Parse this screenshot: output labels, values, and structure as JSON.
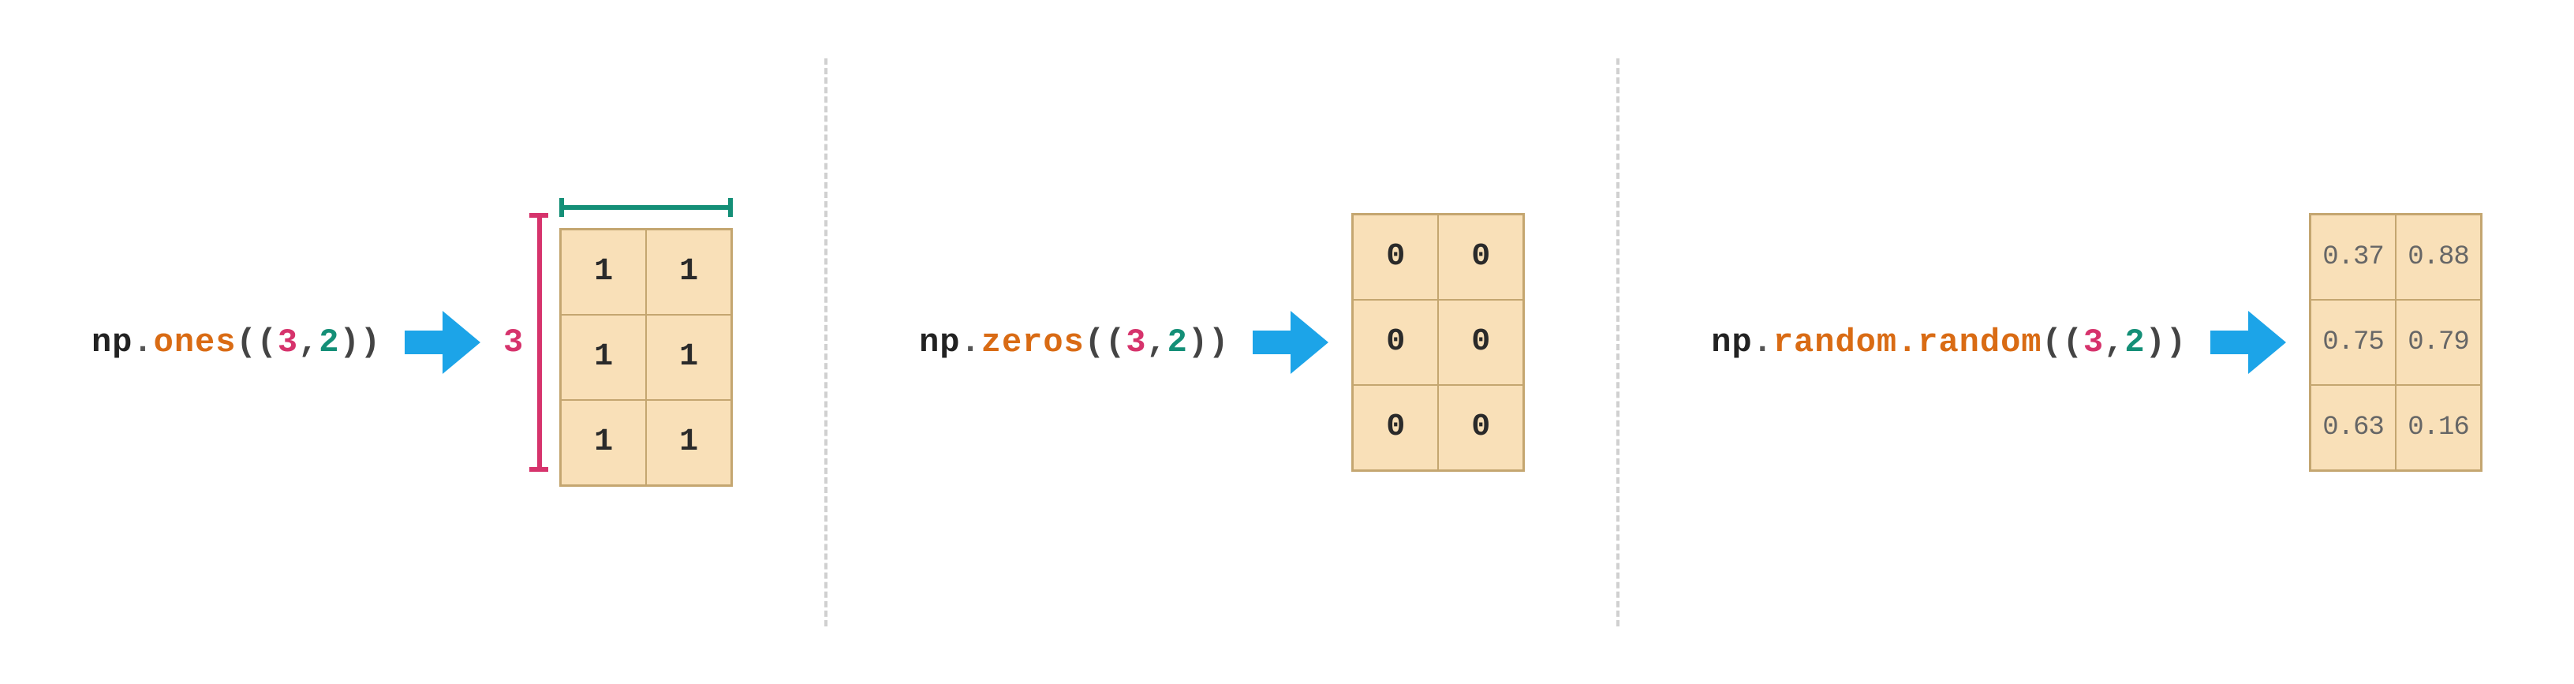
{
  "panels": [
    {
      "code": {
        "module": "np",
        "fn": "ones",
        "arg1": "3",
        "arg2": "2"
      },
      "show_dims": true,
      "dim_label": "3",
      "cells": [
        "1",
        "1",
        "1",
        "1",
        "1",
        "1"
      ],
      "small_cells": false
    },
    {
      "code": {
        "module": "np",
        "fn": "zeros",
        "arg1": "3",
        "arg2": "2"
      },
      "show_dims": false,
      "cells": [
        "0",
        "0",
        "0",
        "0",
        "0",
        "0"
      ],
      "small_cells": false
    },
    {
      "code": {
        "module": "np",
        "fn": "random.random",
        "arg1": "3",
        "arg2": "2"
      },
      "show_dims": false,
      "cells": [
        "0.37",
        "0.88",
        "0.75",
        "0.79",
        "0.63",
        "0.16"
      ],
      "small_cells": true
    }
  ],
  "colors": {
    "arrow": "#1ca4e8",
    "cell_bg": "#f9e0b8",
    "cell_border": "#c4a670",
    "fn": "#d96b14",
    "dim_rows": "#d6336c",
    "dim_cols": "#148f77"
  }
}
